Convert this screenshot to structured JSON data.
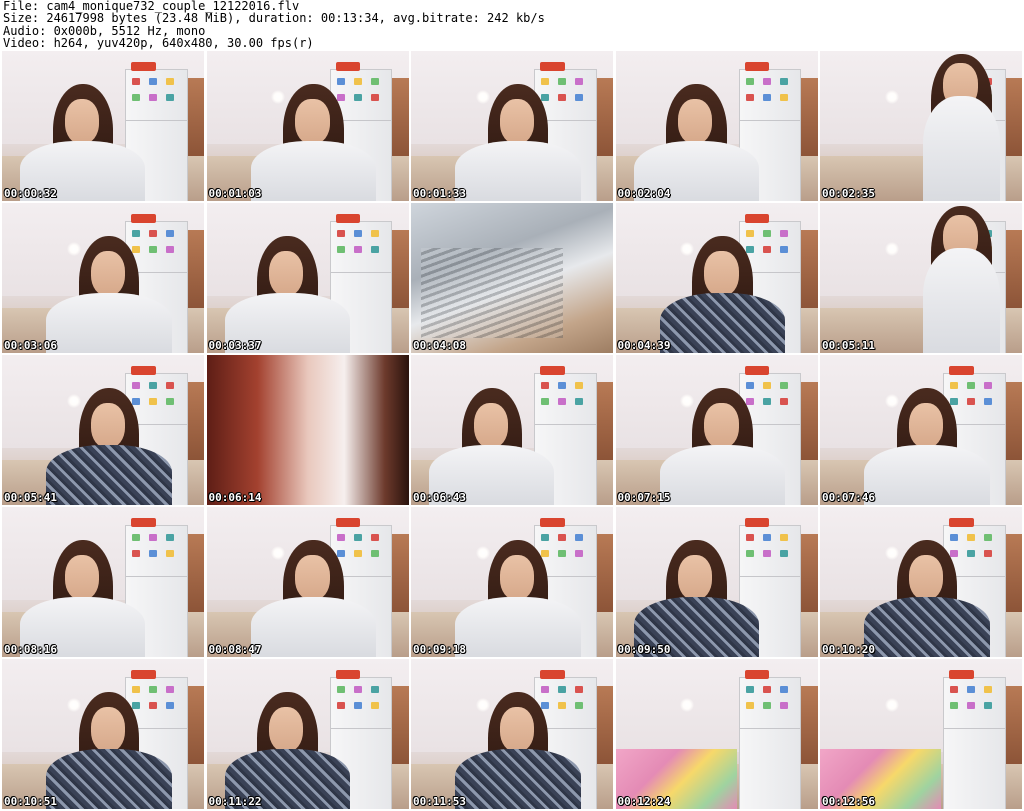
{
  "header": {
    "file_line": "File: cam4_monique732_couple_12122016.flv",
    "size_line": "Size: 24617998 bytes (23.48 MiB), duration: 00:13:34, avg.bitrate: 242 kb/s",
    "audio_line": "Audio: 0x000b, 5512 Hz, mono",
    "video_line": "Video: h264, yuv420p, 640x480, 30.00 fps(r)"
  },
  "thumbnails": [
    {
      "timestamp": "00:00:32",
      "scene": "white-top-stretch"
    },
    {
      "timestamp": "00:01:03",
      "scene": "white-top"
    },
    {
      "timestamp": "00:01:33",
      "scene": "white-top"
    },
    {
      "timestamp": "00:02:04",
      "scene": "white-top-low"
    },
    {
      "timestamp": "00:02:35",
      "scene": "standing"
    },
    {
      "timestamp": "00:03:06",
      "scene": "white-top"
    },
    {
      "timestamp": "00:03:37",
      "scene": "white-top"
    },
    {
      "timestamp": "00:04:08",
      "scene": "laptop-blur"
    },
    {
      "timestamp": "00:04:39",
      "scene": "print-top"
    },
    {
      "timestamp": "00:05:11",
      "scene": "standing"
    },
    {
      "timestamp": "00:05:41",
      "scene": "print-top"
    },
    {
      "timestamp": "00:06:14",
      "scene": "red-blur"
    },
    {
      "timestamp": "00:06:43",
      "scene": "white-top"
    },
    {
      "timestamp": "00:07:15",
      "scene": "white-top-low"
    },
    {
      "timestamp": "00:07:46",
      "scene": "white-top-low"
    },
    {
      "timestamp": "00:08:16",
      "scene": "white-top"
    },
    {
      "timestamp": "00:08:47",
      "scene": "white-top"
    },
    {
      "timestamp": "00:09:18",
      "scene": "white-top"
    },
    {
      "timestamp": "00:09:50",
      "scene": "print-top"
    },
    {
      "timestamp": "00:10:20",
      "scene": "print-top"
    },
    {
      "timestamp": "00:10:51",
      "scene": "print-top"
    },
    {
      "timestamp": "00:11:22",
      "scene": "print-top"
    },
    {
      "timestamp": "00:11:53",
      "scene": "print-top"
    },
    {
      "timestamp": "00:12:24",
      "scene": "empty-kitchen"
    },
    {
      "timestamp": "00:12:56",
      "scene": "empty-kitchen"
    }
  ],
  "colors": {
    "background": "#ffffff",
    "header_text": "#000000",
    "timestamp_text": "#ffffff",
    "timestamp_outline": "#000000"
  }
}
